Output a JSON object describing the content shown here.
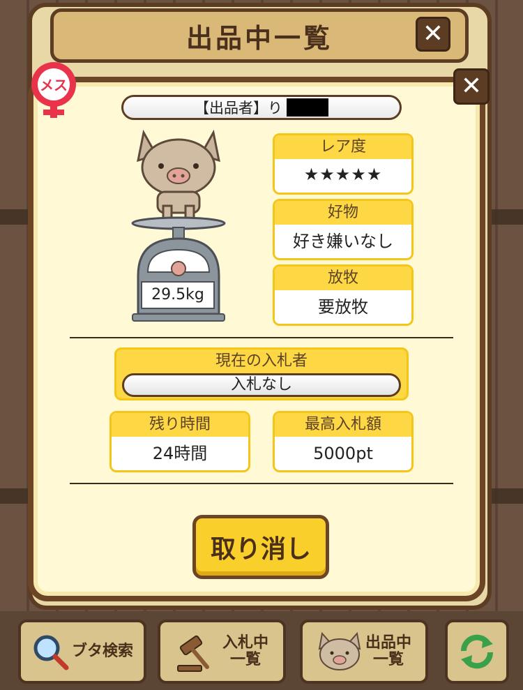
{
  "outer_title": "出品中一覧",
  "close_label": "✕",
  "gender_label": "メス",
  "seller": {
    "prefix": "【出品者】",
    "name": "り"
  },
  "weight": "29.5kg",
  "rarity": {
    "label": "レア度",
    "stars": "★★★★★",
    "value": 5,
    "max": 5
  },
  "favorite": {
    "label": "好物",
    "value": "好き嫌いなし"
  },
  "grazing": {
    "label": "放牧",
    "value": "要放牧"
  },
  "current_bidder": {
    "label": "現在の入札者",
    "value": "入札なし"
  },
  "remaining_time": {
    "label": "残り時間",
    "value": "24時間"
  },
  "max_bid": {
    "label": "最高入札額",
    "value": "5000pt"
  },
  "cancel_label": "取り消し",
  "nav": {
    "search": "ブタ検索",
    "bidding_l1": "入札中",
    "bidding_l2": "一覧",
    "listing_l1": "出品中",
    "listing_l2": "一覧"
  },
  "colors": {
    "accent": "#fdd744",
    "frame": "#6b4526",
    "star": "#ef7e7e",
    "panel": "#fff9d6"
  }
}
